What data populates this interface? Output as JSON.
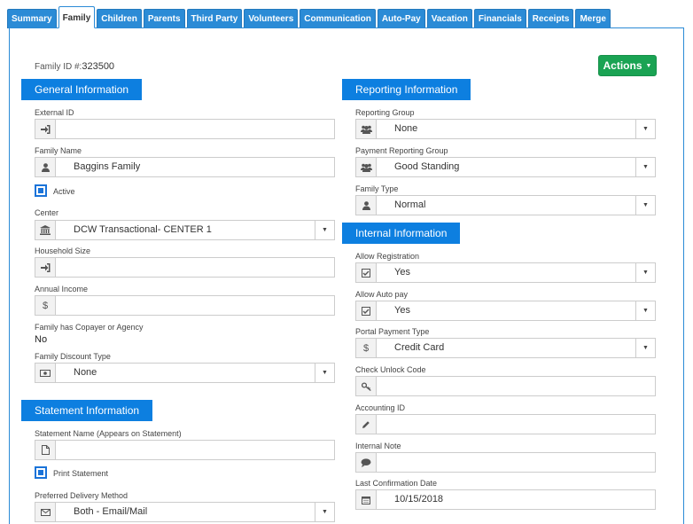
{
  "tabs": [
    {
      "label": "Summary",
      "active": false
    },
    {
      "label": "Family",
      "active": true
    },
    {
      "label": "Children",
      "active": false
    },
    {
      "label": "Parents",
      "active": false
    },
    {
      "label": "Third Party",
      "active": false
    },
    {
      "label": "Volunteers",
      "active": false
    },
    {
      "label": "Communication",
      "active": false
    },
    {
      "label": "Auto-Pay",
      "active": false
    },
    {
      "label": "Vacation",
      "active": false
    },
    {
      "label": "Financials",
      "active": false
    },
    {
      "label": "Receipts",
      "active": false
    },
    {
      "label": "Merge",
      "active": false
    }
  ],
  "family_id_label": "Family ID #:",
  "family_id_value": "323500",
  "actions_label": "Actions",
  "general": {
    "title": "General Information",
    "external_id": {
      "label": "External ID",
      "value": ""
    },
    "family_name": {
      "label": "Family Name",
      "value": "Baggins Family"
    },
    "active_label": "Active",
    "center": {
      "label": "Center",
      "value": "DCW Transactional- CENTER 1"
    },
    "household_size": {
      "label": "Household Size",
      "value": ""
    },
    "annual_income": {
      "label": "Annual Income",
      "value": ""
    },
    "copayer": {
      "label": "Family has Copayer or Agency",
      "value": "No"
    },
    "discount_type": {
      "label": "Family Discount Type",
      "value": "None"
    }
  },
  "statement": {
    "title": "Statement Information",
    "statement_name": {
      "label": "Statement Name (Appears on Statement)",
      "value": ""
    },
    "print_label": "Print Statement",
    "delivery": {
      "label": "Preferred Delivery Method",
      "value": "Both - Email/Mail"
    }
  },
  "reporting": {
    "title": "Reporting Information",
    "group": {
      "label": "Reporting Group",
      "value": "None"
    },
    "payment_group": {
      "label": "Payment Reporting Group",
      "value": "Good Standing"
    },
    "family_type": {
      "label": "Family Type",
      "value": "Normal"
    }
  },
  "internal": {
    "title": "Internal Information",
    "allow_registration": {
      "label": "Allow Registration",
      "value": "Yes"
    },
    "allow_autopay": {
      "label": "Allow Auto pay",
      "value": "Yes"
    },
    "portal_payment": {
      "label": "Portal Payment Type",
      "value": "Credit Card"
    },
    "check_unlock": {
      "label": "Check Unlock Code",
      "value": ""
    },
    "accounting_id": {
      "label": "Accounting ID",
      "value": ""
    },
    "internal_note": {
      "label": "Internal Note",
      "value": ""
    },
    "last_confirmation": {
      "label": "Last Confirmation Date",
      "value": "10/15/2018"
    }
  },
  "colors": {
    "tab": "#2b8bd6",
    "section": "#0d7fe0",
    "actions": "#1aa353"
  }
}
